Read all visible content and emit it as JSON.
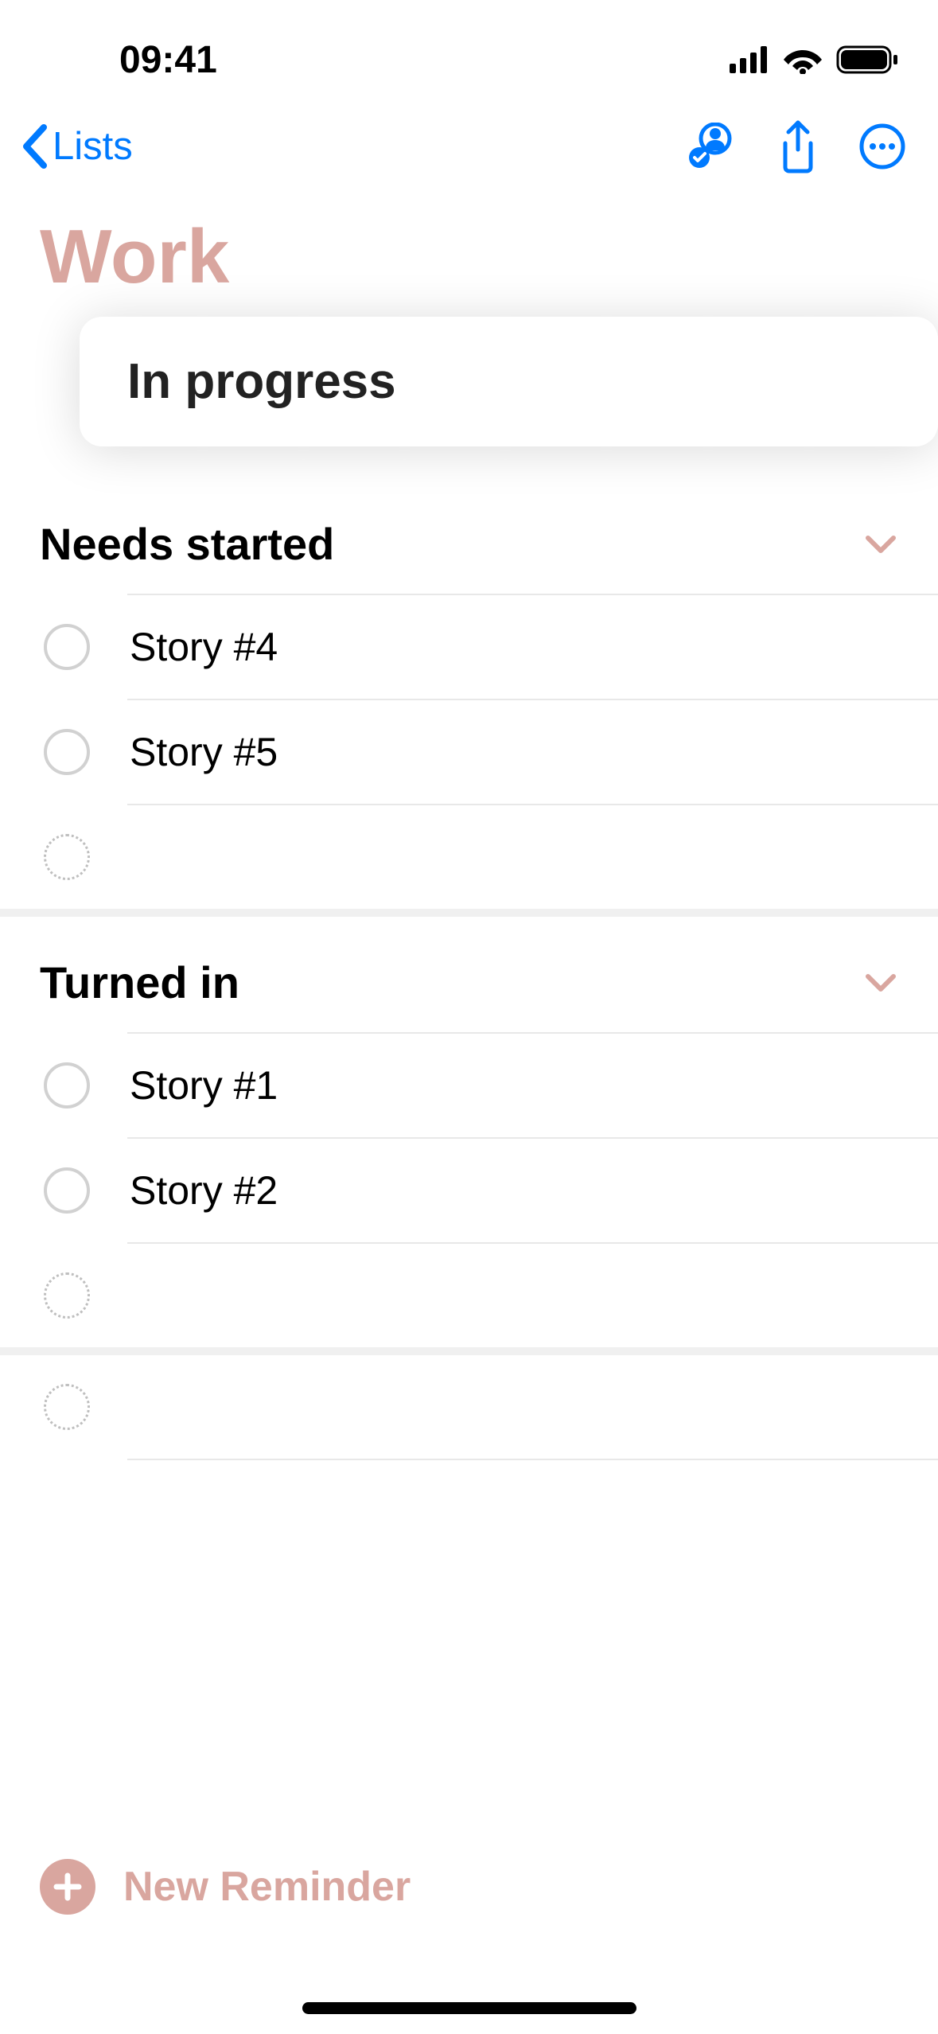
{
  "status": {
    "time": "09:41"
  },
  "nav": {
    "back_label": "Lists"
  },
  "list": {
    "title": "Work",
    "in_progress_label": "In progress"
  },
  "sections": [
    {
      "title": "Needs started",
      "items": [
        {
          "label": "Story #4"
        },
        {
          "label": "Story #5"
        }
      ]
    },
    {
      "title": "Turned in",
      "items": [
        {
          "label": "Story #1"
        },
        {
          "label": "Story #2"
        }
      ]
    }
  ],
  "new_reminder": {
    "label": "New Reminder"
  }
}
